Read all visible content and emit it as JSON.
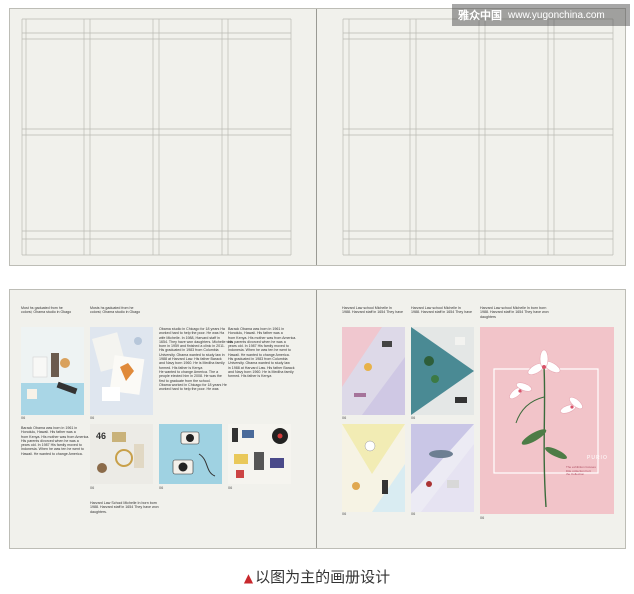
{
  "watermark": {
    "logo": "雅众中国",
    "url": "www.yugonchina.com"
  },
  "left_page": {
    "blocks": [
      {
        "text": "Most hs gaduated from he\ncolorsi; Ohama studio in Okago"
      },
      {
        "text": "Mosts hs gaduated from he\ncolorsi; Ohama studio in Okago"
      },
      {
        "text": "Obama studio in Chicago for 18 years Ha\nworked hard to help the poor. He was Ha\nwife Michelle. In 1988, Harvard staff in\n1654. They have won daughters. Michelle was\nborn in 1959 and finished a clinic in 2011.\nHis graduated in 1983 from Columbia\nUniversity. Obama wanted to study law in\n1988 at Harvard Law. His father Barack\nand Navy born 1960. He is Mediha family\nformed. His father is Kenya\nHe wanted to change America. The a\npeople elected him in 2008. He was the\nfirst to graduate from the school.\nObama worked in Chicago for 18 years He\nworked hard to help the poor. He was"
      },
      {
        "text": "Barack Obama was born in 1961 in\nHonolulu, Hawaii. His father was a\nfrom Kenya. His mother was from America.\nHis parents divorced when he was a\nyears old. In 1987 His family moved to\nIndonesia. When he was ten he went to\nHawaii. He wanted to change America.\nHis graduated in 1983 from Columbia\nUniversity. Obama wanted to study law\nin 1988 at Harvard Law. His father Barack\nand Navy born 1960. He is Mediha family\nformed. His father is Kenya"
      },
      {
        "text": "Barack Obama was born in 1961 in\nHonolulu, Hawaii. His father was a\nfrom Kenya. His mother was from America.\nHis parents divorced when he was a\nyears old. In 1987 His family moved to\nIndonesia. When he was ten he went to\nHawaii. He wanted to change America."
      },
      {
        "text": "Harvard Law School Michelle In born born\n1988. Harvard staff in 1654 They have won\ndaughters."
      }
    ],
    "page_numbers": [
      "06",
      "06",
      "06",
      "06",
      "06"
    ],
    "photo_number_label": "46"
  },
  "right_page": {
    "blocks": [
      {
        "text": "Harvard Law school Michelle In\n1988. Harvard staff in 1654 They have"
      },
      {
        "text": "Harvard Law school Michelle In\n1988. Harvard staff in 1654 They have"
      },
      {
        "text": "Harvard Law school Michelle In born born\n1988. Harvard staff in 1654 They have won\ndaughters"
      }
    ],
    "page_numbers": [
      "06",
      "06",
      "06",
      "06",
      "06"
    ],
    "poster": {
      "title": "PURIO",
      "subtitle": "The exhibition focuses\nlittle collection hort\nthe Collection"
    }
  },
  "caption": {
    "marker": "▲",
    "text": "以图为主的画册设计"
  },
  "colors": {
    "page": "#f1f1ec",
    "grid_line": "#b9b9b3",
    "pink": "#f2c4c9",
    "teal": "#4a8a94",
    "sky": "#a9d6e6",
    "yellow": "#f2ecb4",
    "lavender": "#c9c6e6",
    "caption_marker": "#c8282d"
  }
}
